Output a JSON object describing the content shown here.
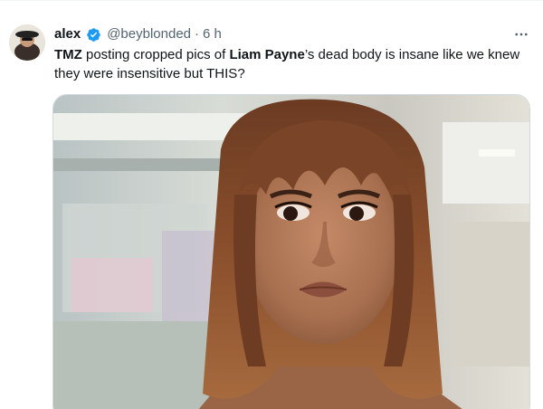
{
  "tweet": {
    "author": {
      "display_name": "alex",
      "handle": "@beyblonded",
      "separator": "·",
      "timestamp": "6 h",
      "verified": true,
      "verified_color": "#1d9bf0",
      "avatar_icon": "profile-avatar"
    },
    "text": {
      "part1": "TMZ",
      "part2": " posting cropped pics of ",
      "part3": "Liam Payne",
      "part4": "’s dead body is insane like we knew they were insensitive but THIS?"
    },
    "more_icon": "more-horizontal-icon",
    "media": {
      "type": "photo",
      "subject": "meme-reaction-woman-with-bangs"
    }
  }
}
